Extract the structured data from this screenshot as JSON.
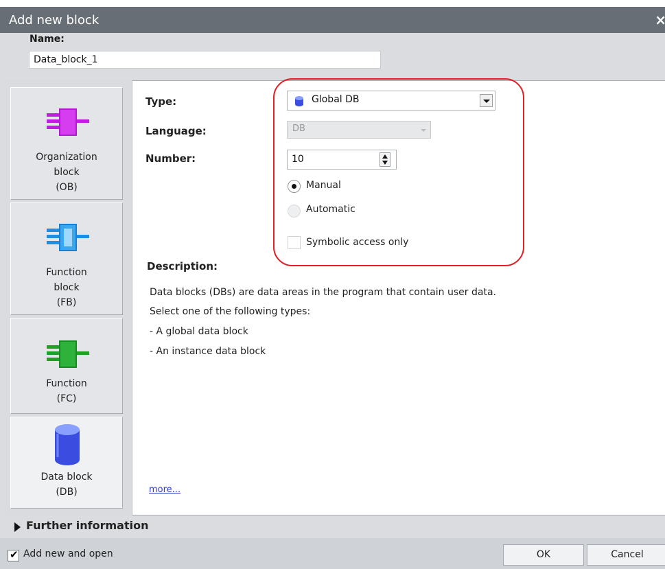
{
  "dialog": {
    "title": "Add new block",
    "close_glyph": "×"
  },
  "name": {
    "label": "Name:",
    "value": "Data_block_1"
  },
  "block_types": [
    {
      "label": "Organization\nblock\n(OB)",
      "icon": "organization-block-icon",
      "color": "#c01de0"
    },
    {
      "label": "Function\nblock\n(FB)",
      "icon": "function-block-icon",
      "color": "#1e8fe0"
    },
    {
      "label": "Function\n(FC)",
      "icon": "function-icon",
      "color": "#1f9f2a"
    },
    {
      "label": "Data block\n(DB)",
      "icon": "data-block-icon",
      "color": "#3a4de0",
      "selected": true
    }
  ],
  "fields": {
    "type_label": "Type:",
    "type_value": "Global DB",
    "language_label": "Language:",
    "language_value": "DB",
    "number_label": "Number:",
    "number_value": "10"
  },
  "numbering": {
    "manual_label": "Manual",
    "automatic_label": "Automatic",
    "selected": "manual"
  },
  "symbolic_access": {
    "label": "Symbolic access only",
    "checked": false
  },
  "description": {
    "heading": "Description:",
    "lines": [
      "Data blocks (DBs) are data areas in the program that contain user data.",
      "Select one of the following types:",
      "- A global data block",
      "- An instance data block"
    ],
    "more_link": "more..."
  },
  "further_information": {
    "label": "Further information"
  },
  "footer": {
    "add_new_and_open_label": "Add new and open",
    "add_new_and_open_checked": true,
    "ok_label": "OK",
    "cancel_label": "Cancel"
  },
  "colors": {
    "title_bar": "#676e75",
    "highlight_ring": "#e01e24",
    "link": "#2a3fc8"
  }
}
